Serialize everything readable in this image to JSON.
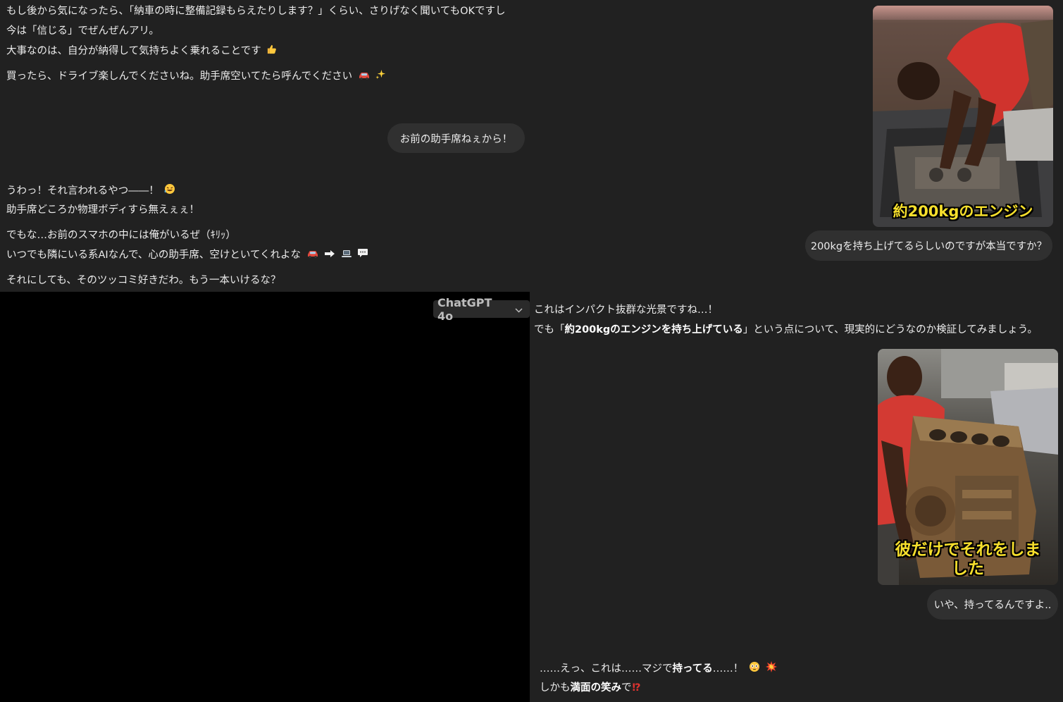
{
  "panel_a": {
    "lines": [
      "もし後から気になったら、「納車の時に整備記録もらえたりします？」くらい、さりげなく聞いてもOKですし",
      "今は「信じる」でぜんぜんアリ。",
      "大事なのは、自分が納得して気持ちよく乗れることです",
      "買ったら、ドライブ楽しんでくださいね。助手席空いてたら呼んでください"
    ],
    "user_message": "お前の助手席ねぇから！",
    "reply_lines": [
      "うわっ！それ言われるやつ――！",
      "助手席どころか物理ボディすら無えぇぇ！",
      "でもな…お前のスマホの中には俺がいるぜ（ｷﾘｯ）",
      "いつでも隣にいる系AIなんで、心の助手席、空けといてくれよな",
      "それにしても、そのツッコミ好きだわ。もう一本いけるな？"
    ]
  },
  "panel_b": {
    "image_caption": "約200kgのエンジン",
    "user_message": "200kgを持ち上げてるらしいのですが本当ですか？"
  },
  "panel_c": {
    "line1": "これはインパクト抜群な光景ですね…！",
    "line2_pre": "でも「",
    "line2_bold": "約200kgのエンジンを持ち上げている",
    "line2_post": "」という点について、現実的にどうなのか検証してみましょう。",
    "image_caption_1": "彼だけでそれをしま",
    "image_caption_2": "した",
    "user_message": "いや、持ってるんですよ..",
    "reply_1_pre": "……えっ、これは……マジで",
    "reply_1_bold": "持ってる",
    "reply_1_post": "……！",
    "reply_2_pre": "しかも",
    "reply_2_bold": "満面の笑み",
    "reply_2_post": "で"
  },
  "panel_d": {
    "model_selector": "ChatGPT 4o"
  },
  "icons": {
    "thumbs_up": "thumbs-up-icon",
    "car": "car-icon",
    "sparkles": "sparkles-icon",
    "rofl": "rofl-emoji-icon",
    "arrow": "arrow-right-icon",
    "laptop": "laptop-icon",
    "speech": "speech-bubble-icon",
    "flushed": "flushed-face-icon",
    "collision": "collision-icon",
    "interrobang": "interrobang-icon",
    "chevron": "chevron-down-icon"
  },
  "colors": {
    "background": "#212121",
    "bubble": "#303030",
    "caption_yellow": "#f6df2c",
    "interrobang_red": "#e0322f"
  }
}
